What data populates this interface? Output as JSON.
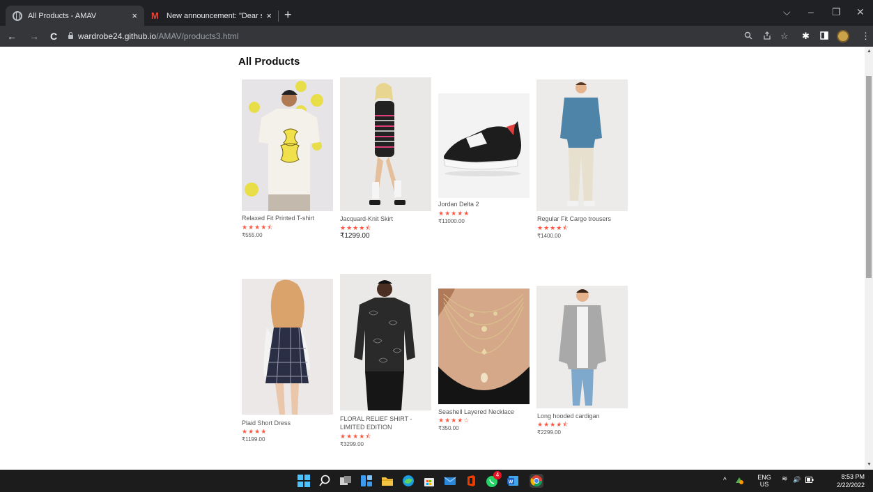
{
  "browser": {
    "tabs": [
      {
        "title": "All Products - AMAV",
        "close": "×"
      },
      {
        "title": "New announcement: \"Dear stude",
        "close": "×"
      }
    ],
    "new_tab": "+",
    "window_controls": {
      "dropdown": "⌵",
      "minimize": "–",
      "maximize": "❐",
      "close": "✕"
    },
    "nav": {
      "back": "←",
      "forward": "→",
      "reload": "C"
    },
    "url_host": "wardrobe24.github.io",
    "url_path": "/AMAV/products3.html",
    "toolbar_icons": {
      "zoom": "🔍",
      "share": "⇪",
      "bookmark": "☆",
      "extensions": "✱",
      "sidepanel": "◧",
      "menu": "⋮"
    }
  },
  "page": {
    "heading": "All Products",
    "products": [
      {
        "name": "Relaxed Fit Printed T-shirt",
        "stars": "★★★★⯪",
        "price": "₹555.00",
        "image_icon": "tshirt-photo"
      },
      {
        "name": "Jacquard-Knit Skirt",
        "stars": "★★★★⯪",
        "price": "₹1299.00",
        "image_icon": "skirt-photo"
      },
      {
        "name": "Jordan Delta 2",
        "stars": "★★★★★",
        "price": "₹11000.00",
        "image_icon": "sneaker-photo"
      },
      {
        "name": "Regular Fit Cargo trousers",
        "stars": "★★★★⯪",
        "price": "₹1400.00",
        "image_icon": "trousers-photo"
      },
      {
        "name": "Plaid Short Dress",
        "stars": "★★★★",
        "price": "₹1199.00",
        "image_icon": "dress-photo"
      },
      {
        "name": "FLORAL RELIEF SHIRT - LIMITED EDITION",
        "stars": "★★★★⯪",
        "price": "₹3299.00",
        "image_icon": "shirt-photo"
      },
      {
        "name": "Seashell Layered Necklace",
        "stars": "★★★★☆",
        "price": "₹350.00",
        "image_icon": "necklace-photo"
      },
      {
        "name": "Long hooded cardigan",
        "stars": "★★★★⯪",
        "price": "₹2299.00",
        "image_icon": "cardigan-photo"
      }
    ]
  },
  "taskbar": {
    "tray_lang": "ENG",
    "tray_region": "US",
    "time": "8:53 PM",
    "date": "2/22/2022",
    "notification_badge": "4",
    "chevron": "^",
    "wifi": "≋",
    "volume": "🔊"
  },
  "colors": {
    "star": "#ff523b",
    "chrome_dark": "#202124",
    "chrome_toolbar": "#35363a",
    "taskbar": "#1c1c1c"
  }
}
